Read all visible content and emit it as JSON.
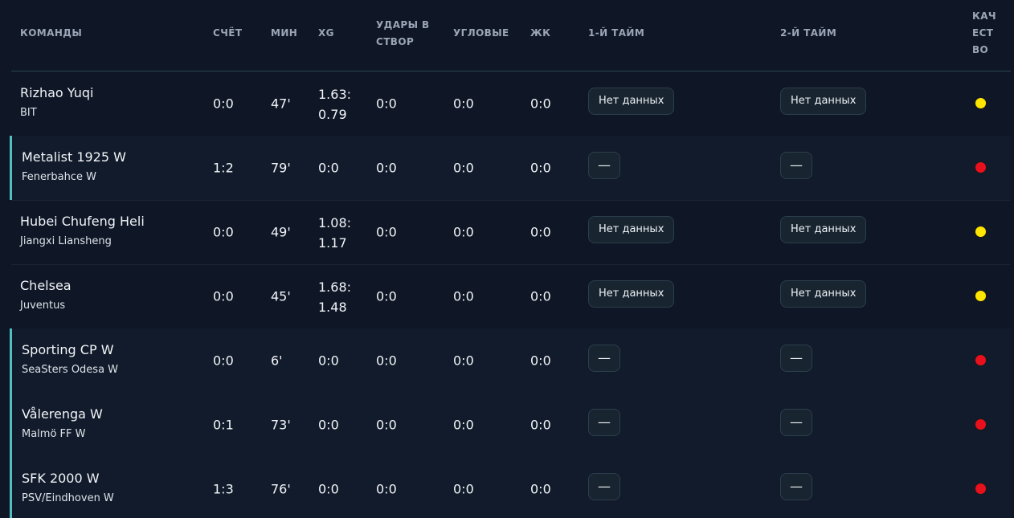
{
  "colors": {
    "background": "#0f1626",
    "header_text": "#9aa6b6",
    "live_accent": "#4fc0bf",
    "quality_yellow": "#ffe600",
    "quality_red": "#e8101d",
    "chip_bg": "#18242f"
  },
  "header": {
    "teams": "КОМАНДЫ",
    "score": "СЧЁТ",
    "minute": "МИН",
    "xg": "XG",
    "shots_line1": "УДАРЫ В",
    "shots_line2": "СТВОР",
    "corners": "УГЛОВЫЕ",
    "yellow_cards": "ЖК",
    "first_half": "1-Й ТАЙМ",
    "second_half": "2-Й ТАЙМ",
    "quality_line1": "КАЧ",
    "quality_line2": "ЕСТ",
    "quality_line3": "ВО"
  },
  "rows": [
    {
      "home": "Rizhao Yuqi",
      "away": "BIT",
      "score": "0:0",
      "minute": "47'",
      "xg": "1.63:0.79",
      "shots": "0:0",
      "corners": "0:0",
      "cards": "0:0",
      "h1": "Нет данных",
      "h2": "Нет данных",
      "quality": "yellow",
      "live": false
    },
    {
      "home": "Metalist 1925 W",
      "away": "Fenerbahce W",
      "score": "1:2",
      "minute": "79'",
      "xg": "0:0",
      "shots": "0:0",
      "corners": "0:0",
      "cards": "0:0",
      "h1": "—",
      "h2": "—",
      "quality": "red",
      "live": true
    },
    {
      "home": "Hubei Chufeng Heli",
      "away": "Jiangxi Liansheng",
      "score": "0:0",
      "minute": "49'",
      "xg": "1.08:1.17",
      "shots": "0:0",
      "corners": "0:0",
      "cards": "0:0",
      "h1": "Нет данных",
      "h2": "Нет данных",
      "quality": "yellow",
      "live": false
    },
    {
      "home": "Chelsea",
      "away": "Juventus",
      "score": "0:0",
      "minute": "45'",
      "xg": "1.68:1.48",
      "shots": "0:0",
      "corners": "0:0",
      "cards": "0:0",
      "h1": "Нет данных",
      "h2": "Нет данных",
      "quality": "yellow",
      "live": false
    },
    {
      "home": "Sporting CP W",
      "away": "SeaSters Odesa W",
      "score": "0:0",
      "minute": "6'",
      "xg": "0:0",
      "shots": "0:0",
      "corners": "0:0",
      "cards": "0:0",
      "h1": "—",
      "h2": "—",
      "quality": "red",
      "live": true
    },
    {
      "home": "Vålerenga W",
      "away": "Malmö FF W",
      "score": "0:1",
      "minute": "73'",
      "xg": "0:0",
      "shots": "0:0",
      "corners": "0:0",
      "cards": "0:0",
      "h1": "—",
      "h2": "—",
      "quality": "red",
      "live": true
    },
    {
      "home": "SFK 2000 W",
      "away": "PSV/Eindhoven W",
      "score": "1:3",
      "minute": "76'",
      "xg": "0:0",
      "shots": "0:0",
      "corners": "0:0",
      "cards": "0:0",
      "h1": "—",
      "h2": "—",
      "quality": "red",
      "live": true
    }
  ]
}
